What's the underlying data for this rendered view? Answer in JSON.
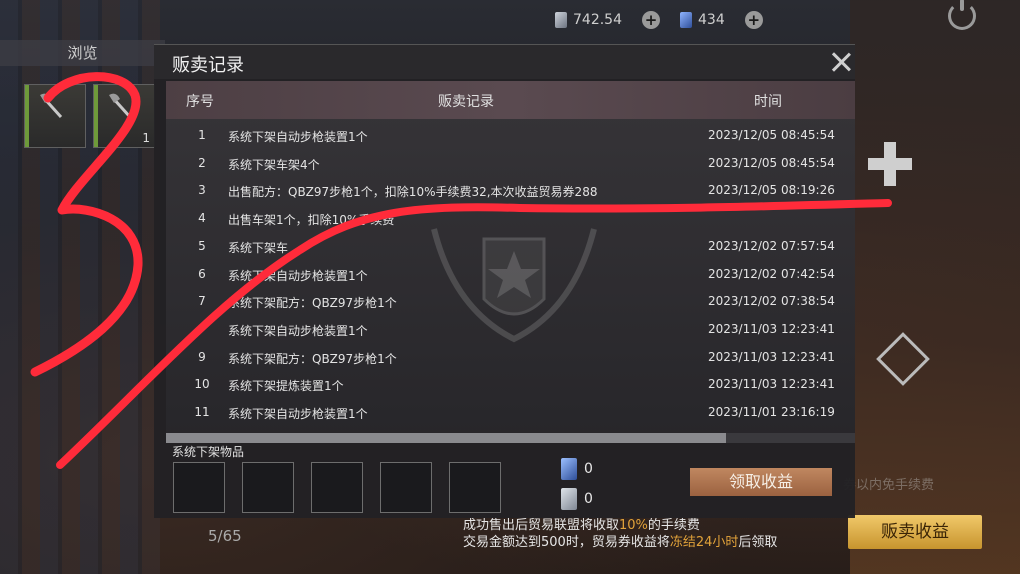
{
  "topbar": {
    "silver_value": "742.54",
    "blue_value": "434"
  },
  "browse": {
    "tab_label": "浏览",
    "items": [
      {
        "count": ""
      },
      {
        "count": "1"
      }
    ],
    "pager": "5/65"
  },
  "modal": {
    "title": "贩卖记录",
    "columns": {
      "no": "序号",
      "record": "贩卖记录",
      "time": "时间"
    },
    "rows": [
      {
        "no": "1",
        "record": "系统下架自动步枪装置1个",
        "time": "2023/12/05 08:45:54"
      },
      {
        "no": "2",
        "record": "系统下架车架4个",
        "time": "2023/12/05 08:45:54"
      },
      {
        "no": "3",
        "record": "出售配方：QBZ97步枪1个，扣除10%手续费32,本次收益贸易券288",
        "time": "2023/12/05 08:19:26"
      },
      {
        "no": "4",
        "record": "出售车架1个，扣除10%手续费",
        "time": ""
      },
      {
        "no": "5",
        "record": "系统下架车",
        "time": "2023/12/02 07:57:54"
      },
      {
        "no": "6",
        "record": "系统下架自动步枪装置1个",
        "time": "2023/12/02 07:42:54"
      },
      {
        "no": "7",
        "record": "系统下架配方：QBZ97步枪1个",
        "time": "2023/12/02 07:38:54"
      },
      {
        "no": "",
        "record": "系统下架自动步枪装置1个",
        "time": "2023/11/03 12:23:41"
      },
      {
        "no": "9",
        "record": "系统下架配方：QBZ97步枪1个",
        "time": "2023/11/03 12:23:41"
      },
      {
        "no": "10",
        "record": "系统下架提炼装置1个",
        "time": "2023/11/03 12:23:41"
      },
      {
        "no": "11",
        "record": "系统下架自动步枪装置1个",
        "time": "2023/11/01 23:16:19"
      }
    ],
    "unlisted_title": "系统下架物品",
    "reward_silver": "0",
    "reward_blue": "0",
    "claim_label": "领取收益"
  },
  "footer": {
    "info_line1_a": "成功售出后贸易联盟将收取",
    "info_line1_hl": "10%",
    "info_line1_b": "的手续费",
    "info_line2_a": "交易金额达到500时，贸易券收益将",
    "info_line2_hl": "冻结24小时",
    "info_line2_b": "后领取",
    "sell_revenue_label": "贩卖收益",
    "hidden_tip_right": "券以内免手续费"
  },
  "colors": {
    "accent_gold": "#e1a23a",
    "claim_button": "#b07a55",
    "annotation_red": "#ff2b3a"
  }
}
